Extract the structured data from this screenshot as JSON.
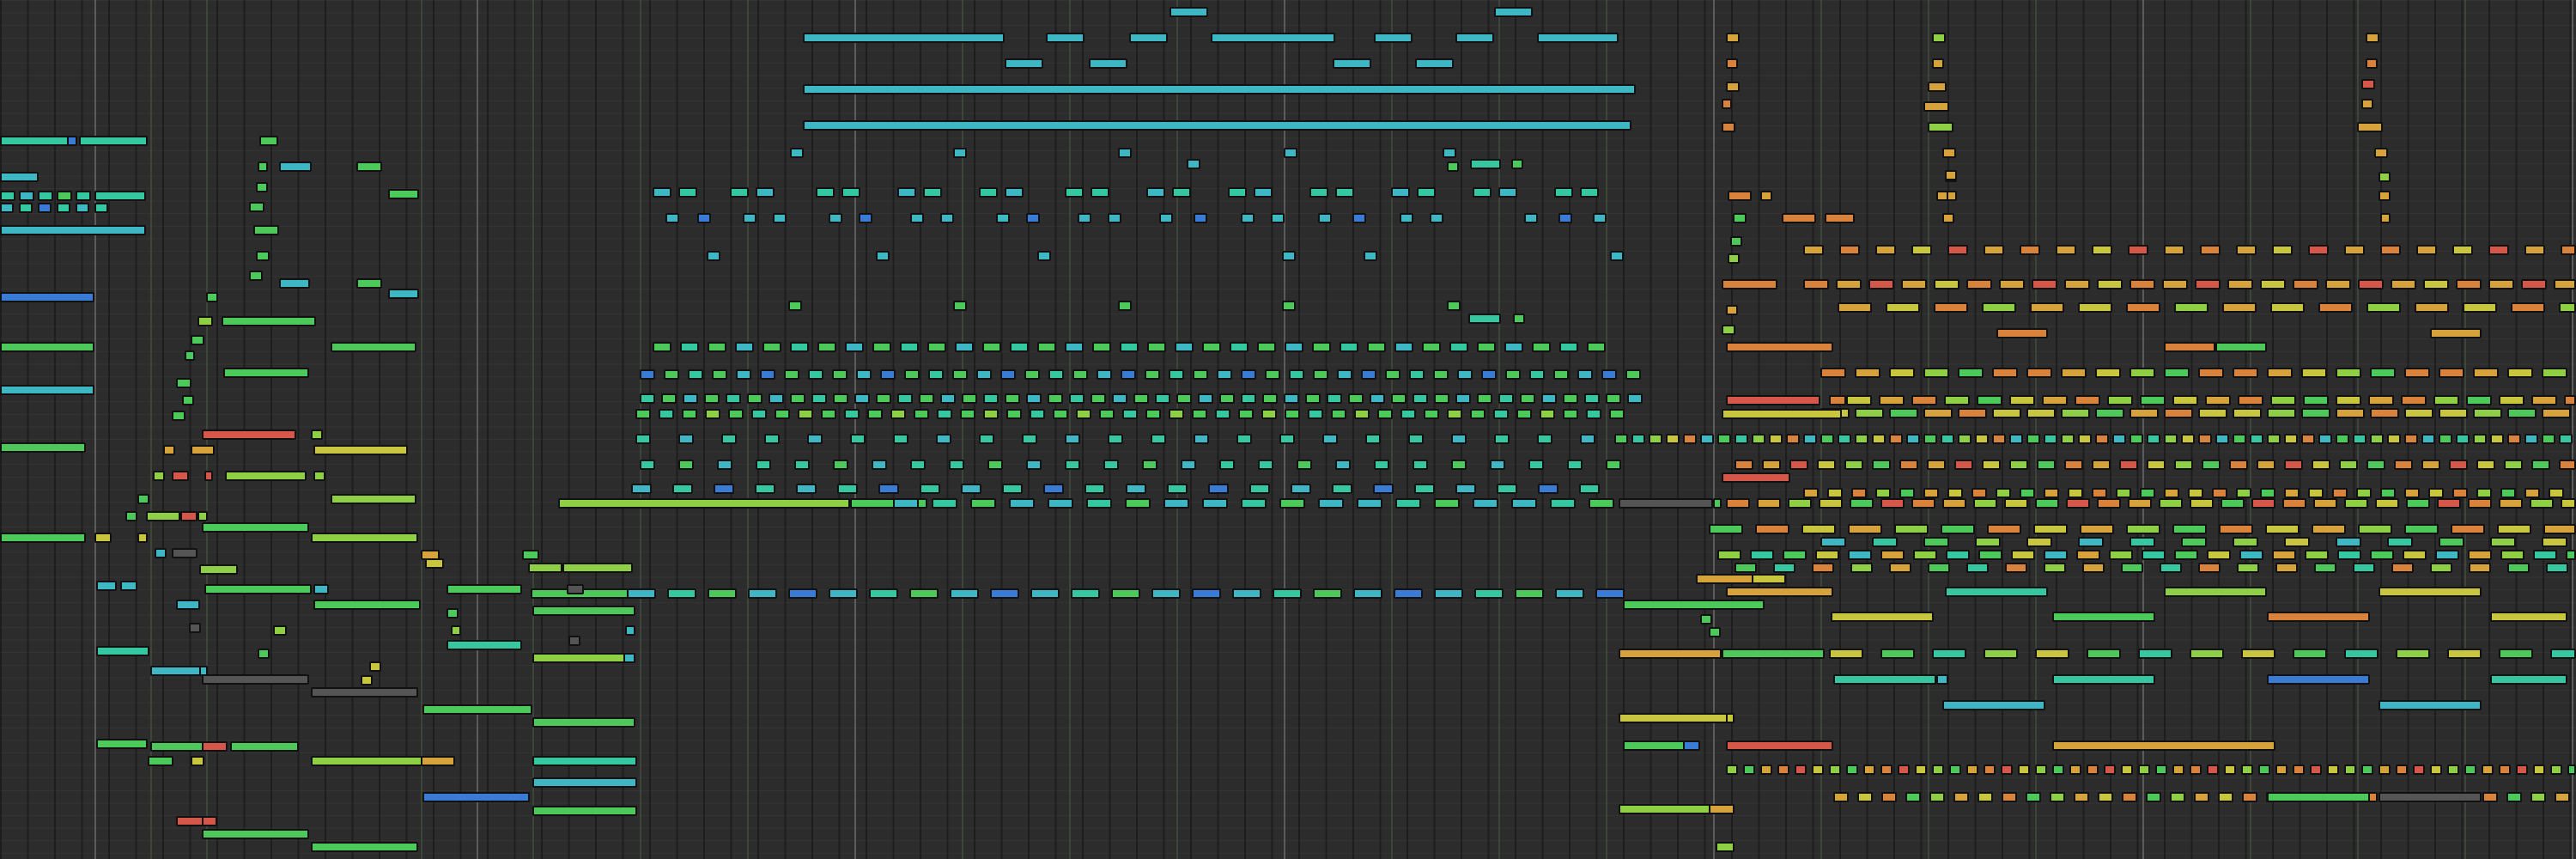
{
  "view": {
    "name": "piano-roll",
    "palette": {
      "cyan": "#3fb6c4",
      "teal": "#35c8a0",
      "blue": "#3a7bd5",
      "green": "#4cc95a",
      "lime": "#8fcf45",
      "yellow": "#c8c53e",
      "amber": "#d6a23c",
      "orange": "#d8823c",
      "red": "#d4574a",
      "gray": "#555555"
    },
    "grid_lines": {
      "bar_color": "#8a8a8a",
      "section_color": "#4a6a40"
    }
  }
}
